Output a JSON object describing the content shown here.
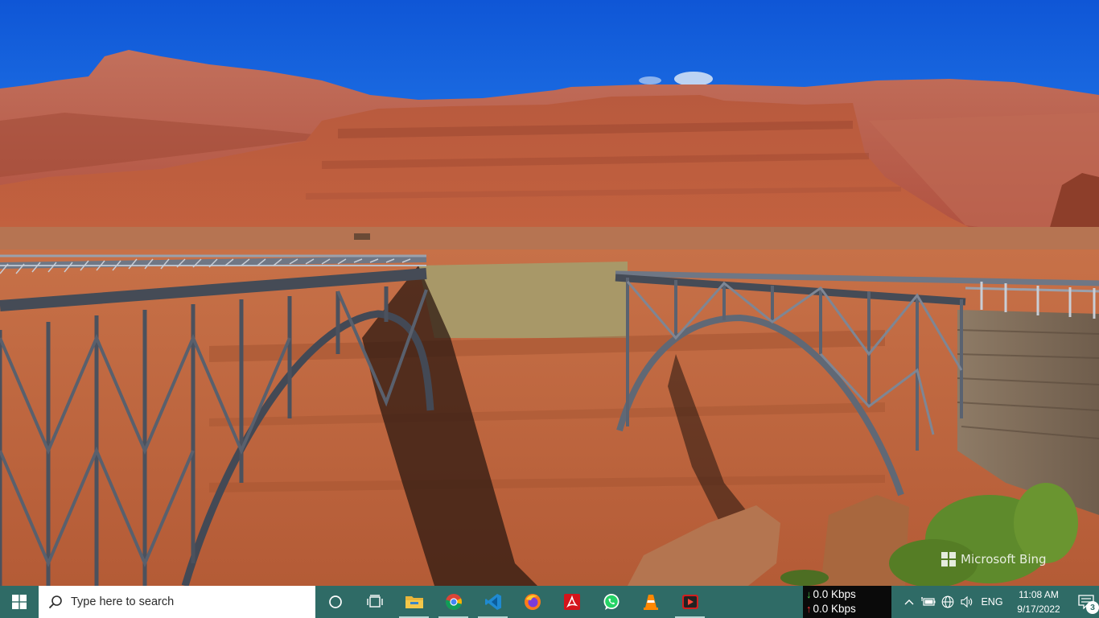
{
  "desktop": {
    "wallpaper": "bridges-over-red-canyon",
    "watermark": "Microsoft Bing"
  },
  "taskbar": {
    "start_icon": "windows-logo-icon",
    "search": {
      "placeholder": "Type here to search",
      "icon": "search-icon"
    },
    "pinned_apps": [
      {
        "name": "cortana",
        "icon": "cortana-circle-icon"
      },
      {
        "name": "task-view",
        "icon": "task-view-icon"
      },
      {
        "name": "file-explorer",
        "icon": "folder-icon"
      },
      {
        "name": "google-chrome",
        "icon": "chrome-icon"
      },
      {
        "name": "visual-studio-code",
        "icon": "vscode-icon"
      },
      {
        "name": "firefox",
        "icon": "firefox-icon"
      },
      {
        "name": "adobe-acrobat",
        "icon": "acrobat-icon"
      },
      {
        "name": "whatsapp",
        "icon": "whatsapp-icon"
      },
      {
        "name": "vlc",
        "icon": "vlc-cone-icon"
      },
      {
        "name": "screen-recorder",
        "icon": "recorder-icon"
      }
    ],
    "network_speed": {
      "down": "0.0 Kbps",
      "up": "0.0 Kbps"
    },
    "tray": {
      "language": "ENG",
      "icons": [
        "chevron-up-icon",
        "battery-icon",
        "network-globe-icon",
        "volume-icon"
      ]
    },
    "clock": {
      "time": "11:08 AM",
      "date": "9/17/2022"
    },
    "notifications": {
      "count": "3"
    }
  },
  "colors": {
    "taskbar": "#2f6b66",
    "sky": "#1e6fe0",
    "rock": "#c0593a"
  }
}
